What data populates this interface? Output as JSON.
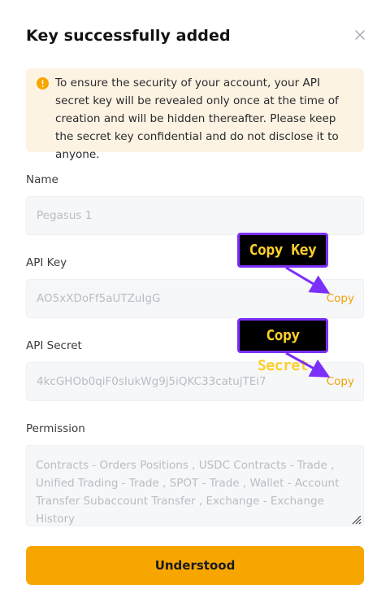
{
  "dialog": {
    "title": "Key successfully added",
    "close_icon": "close-icon"
  },
  "notice": {
    "icon": "exclamation-circle-icon",
    "text": "To ensure the security of your account, your API secret key will be revealed only once at the time of creation and will be hidden thereafter. Please keep the secret key confidential and do not disclose it to anyone."
  },
  "fields": {
    "name": {
      "label": "Name",
      "value": "Pegasus 1"
    },
    "api_key": {
      "label": "API Key",
      "value": "AO5xXDoFf5aUTZuIgG",
      "copy_label": "Copy"
    },
    "api_secret": {
      "label": "API Secret",
      "value": "4kcGHOb0qiF0sIukWg9j5iQKC33catujTEi7",
      "copy_label": "Copy"
    },
    "permission": {
      "label": "Permission",
      "value": "Contracts - Orders Positions  , USDC Contracts - Trade  , Unified Trading - Trade  , SPOT - Trade  , Wallet - Account Transfer Subaccount Transfer  , Exchange - Exchange History"
    }
  },
  "annotations": {
    "copy_key": "Copy Key",
    "copy_secret": "Copy Secret"
  },
  "actions": {
    "understood_label": "Understood"
  },
  "colors": {
    "accent": "#f7a600",
    "link": "#f0a30a",
    "notice_bg": "#fdf3e3",
    "callout_border": "#7b2ff7",
    "callout_text": "#ffd02a"
  }
}
